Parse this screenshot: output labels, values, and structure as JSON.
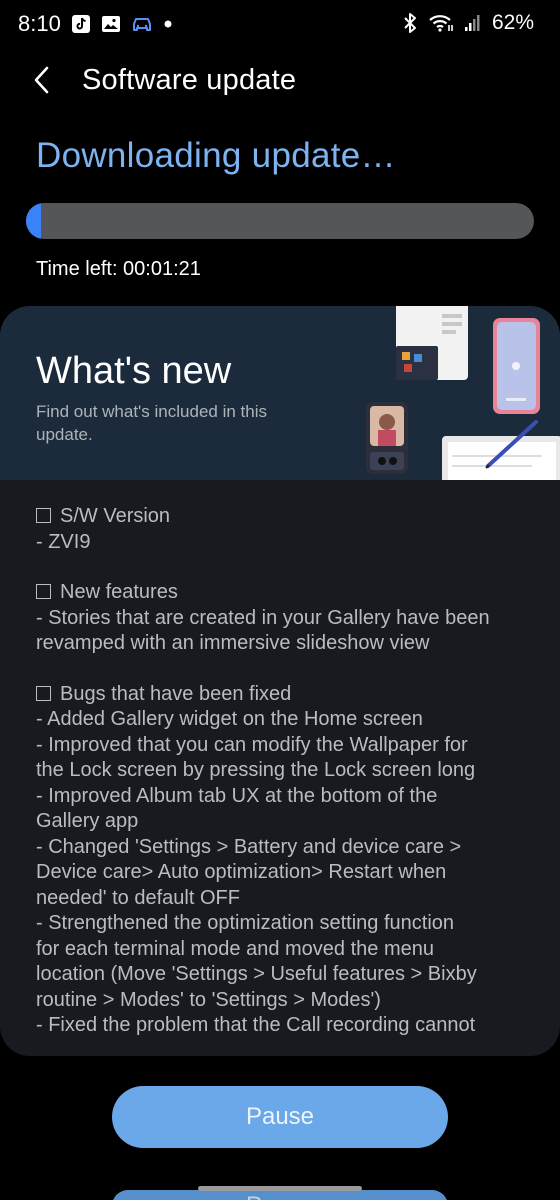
{
  "status_bar": {
    "time": "8:10",
    "battery_percent": "62%",
    "left_icons": [
      "tiktok-icon",
      "gallery-icon",
      "car-icon",
      "notification-dot-icon"
    ],
    "right_icons": [
      "bluetooth-icon",
      "wifi-icon",
      "signal-icon"
    ]
  },
  "header": {
    "title": "Software update",
    "back_icon": "chevron-left-icon"
  },
  "download": {
    "status": "Downloading update…",
    "progress": 0.03,
    "time_left": "Time left: 00:01:21"
  },
  "whats_new": {
    "title": "What's new",
    "subtitle": "Find out what's included in this update.",
    "sections": [
      {
        "heading": "S/W Version",
        "lines": [
          "- ZVI9"
        ]
      },
      {
        "heading": "New features",
        "lines": [
          "- Stories that are created in your Gallery have been",
          "revamped with an immersive slideshow view"
        ]
      },
      {
        "heading": "Bugs that have been fixed",
        "lines": [
          "- Added Gallery widget on the Home screen",
          "- Improved that you can modify the Wallpaper for",
          "the Lock screen by pressing the Lock screen long",
          "- Improved Album tab UX at the bottom of the",
          "Gallery app",
          "- Changed 'Settings > Battery and device care >",
          "Device care> Auto optimization> Restart when",
          "needed' to default OFF",
          "- Strengthened the optimization setting function",
          "for each terminal mode and moved the menu",
          "location (Move 'Settings > Useful features > Bixby",
          "routine > Modes' to 'Settings > Modes')",
          "- Fixed the problem that the Call recording cannot"
        ]
      }
    ]
  },
  "actions": {
    "pause_label": "Pause",
    "secondary_label": "Pause"
  },
  "colors": {
    "accent": "#3a82f7",
    "status_text": "#7db3f0",
    "button": "#6aa8ea",
    "card": "#171a1f",
    "banner": "#1c2b3b"
  }
}
